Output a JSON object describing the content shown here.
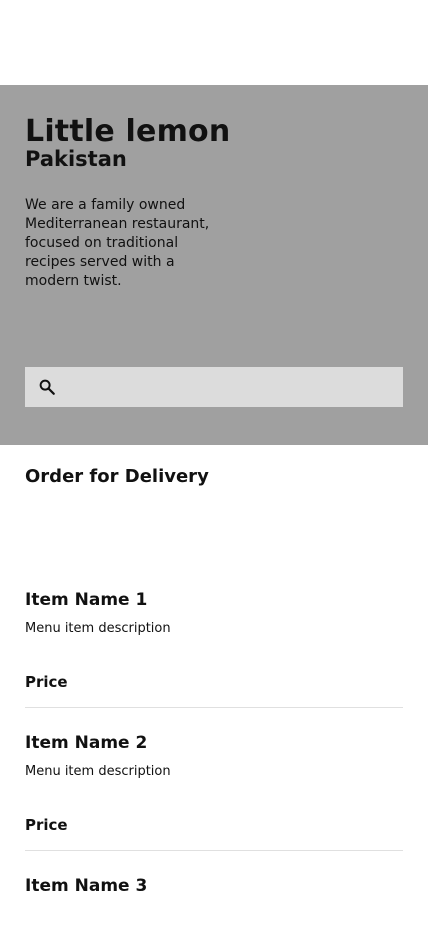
{
  "hero": {
    "title": "Little lemon",
    "subtitle": "Pakistan",
    "description": "We are a family owned Mediterranean restaurant, focused on traditional recipes served with a modern twist.",
    "background_color": "#a0a0a0"
  },
  "search": {
    "icon": "search-icon",
    "placeholder": ""
  },
  "delivery": {
    "heading": "Order for Delivery"
  },
  "menu": {
    "items": [
      {
        "name": "Item Name 1",
        "description": "Menu item description",
        "price": "Price"
      },
      {
        "name": "Item Name 2",
        "description": "Menu item description",
        "price": "Price"
      },
      {
        "name": "Item Name 3"
      }
    ]
  }
}
